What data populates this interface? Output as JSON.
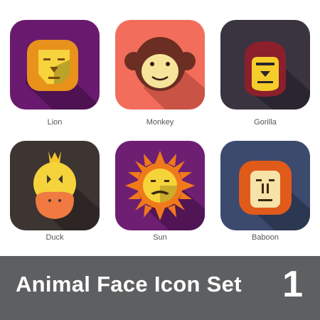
{
  "icons": [
    {
      "label": "Lion",
      "bg": "#6a1a6e",
      "icon": "lion-face-icon"
    },
    {
      "label": "Monkey",
      "bg": "#f26d5b",
      "icon": "monkey-face-icon"
    },
    {
      "label": "Gorilla",
      "bg": "#3a3440",
      "icon": "gorilla-face-icon"
    },
    {
      "label": "Duck",
      "bg": "#3d3532",
      "icon": "duck-face-icon"
    },
    {
      "label": "Sun",
      "bg": "#6e1f72",
      "icon": "sun-face-icon"
    },
    {
      "label": "Baboon",
      "bg": "#3c4a6e",
      "icon": "baboon-face-icon"
    }
  ],
  "footer": {
    "title": "Animal Face Icon Set",
    "number": "1",
    "bg": "#5d5f61"
  }
}
